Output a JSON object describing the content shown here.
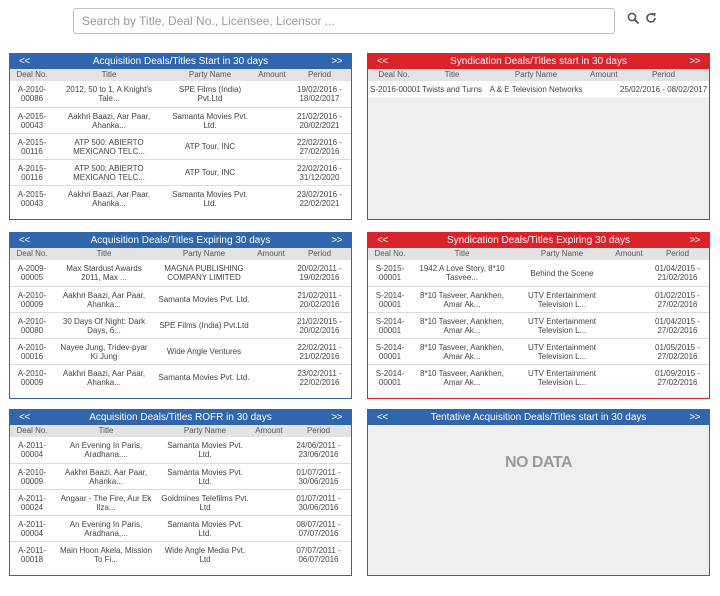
{
  "search": {
    "placeholder": "Search by Title, Deal No., Licensee, Licensor ..."
  },
  "icons": {
    "search": "search-icon",
    "refresh": "refresh-icon"
  },
  "colors": {
    "acquisition": "#2f66ad",
    "syndication": "#d9222a"
  },
  "nav": {
    "prev": "<<",
    "next": ">>"
  },
  "columns": {
    "deal_no": "Deal No.",
    "title": "Title",
    "party_name": "Party Name",
    "amount": "Amount",
    "period": "Period"
  },
  "panels": {
    "acq_start": {
      "title": "Acquisition Deals/Titles Start in 30 days",
      "rows": [
        {
          "deal_no": "A-2010-00086",
          "title": "2012, 50 to 1, A Knight's Tale...",
          "party": "SPE Films (India) Pvt.Ltd",
          "amount": "",
          "period": "19/02/2016 - 18/02/2017"
        },
        {
          "deal_no": "A-2015-00043",
          "title": "Aakhri Baazi, Aar Paar, Ahanka...",
          "party": "Samanta Movies Pvt. Ltd.",
          "amount": "",
          "period": "21/02/2016 - 20/02/2021"
        },
        {
          "deal_no": "A-2015-00116",
          "title": "ATP 500: ABIERTO MEXICANO TELC...",
          "party": "ATP Tour, INC",
          "amount": "",
          "period": "22/02/2016 - 27/02/2016"
        },
        {
          "deal_no": "A-2015-00116",
          "title": "ATP 500: ABIERTO MEXICANO TELC...",
          "party": "ATP Tour, INC",
          "amount": "",
          "period": "22/02/2016 - 31/12/2020"
        },
        {
          "deal_no": "A-2015-00043",
          "title": "Aakhri Baazi, Aar Paar, Ahanka...",
          "party": "Samanta Movies Pvt. Ltd.",
          "amount": "",
          "period": "23/02/2016 - 22/02/2021"
        }
      ]
    },
    "syn_start": {
      "title": "Syndication Deals/Titles start in 30 days",
      "rows": [
        {
          "deal_no": "S-2016-00001",
          "title": "Twists and Turns",
          "party": "A & E Television Networks",
          "amount": "",
          "period": "25/02/2016 - 08/02/2017"
        }
      ]
    },
    "acq_expiring": {
      "title": "Acquisition Deals/Titles Expiring 30 days",
      "rows": [
        {
          "deal_no": "A-2009-00005",
          "title": "Max Stardust Awards 2011, Max ...",
          "party": "MAGNA PUBLISHING COMPANY LIMITED",
          "amount": "",
          "period": "20/02/2011 - 19/02/2016"
        },
        {
          "deal_no": "A-2010-00009",
          "title": "Aakhri Baazi, Aar Paar, Ahanka...",
          "party": "Samanta Movies Pvt. Ltd.",
          "amount": "",
          "period": "21/02/2011 - 20/02/2016"
        },
        {
          "deal_no": "A-2010-00080",
          "title": "30 Days Of Night: Dark Days, 6...",
          "party": "SPE Films (India) Pvt.Ltd",
          "amount": "",
          "period": "21/02/2015 - 20/02/2016"
        },
        {
          "deal_no": "A-2010-00016",
          "title": "Nayee Jung, Tridev-pyar Ki Jung",
          "party": "Wide Angle Ventures",
          "amount": "",
          "period": "22/02/2011 - 21/02/2016"
        },
        {
          "deal_no": "A-2010-00009",
          "title": "Aakhri Baazi, Aar Paar, Ahanka...",
          "party": "Samanta Movies Pvt. Ltd.",
          "amount": "",
          "period": "23/02/2011 - 22/02/2016"
        }
      ]
    },
    "syn_expiring": {
      "title": "Syndication Deals/Titles Expiring 30 days",
      "rows": [
        {
          "deal_no": "S-2015-00001",
          "title": "1942 A Love Story, 8*10 Tasvee...",
          "party": "Behind the Scene",
          "amount": "",
          "period": "01/04/2015 - 21/02/2016"
        },
        {
          "deal_no": "S-2014-00001",
          "title": "8*10 Tasveer, Aankhen, Amar Ak...",
          "party": "UTV Entertainment Television L...",
          "amount": "",
          "period": "01/02/2015 - 27/02/2016"
        },
        {
          "deal_no": "S-2014-00001",
          "title": "8*10 Tasveer, Aankhen, Amar Ak...",
          "party": "UTV Entertainment Television L...",
          "amount": "",
          "period": "01/04/2015 - 27/02/2016"
        },
        {
          "deal_no": "S-2014-00001",
          "title": "8*10 Tasveer, Aankhen, Amar Ak...",
          "party": "UTV Entertainment Television L...",
          "amount": "",
          "period": "01/05/2015 - 27/02/2016"
        },
        {
          "deal_no": "S-2014-00001",
          "title": "8*10 Tasveer, Aankhen, Amar Ak...",
          "party": "UTV Entertainment Television L...",
          "amount": "",
          "period": "01/09/2015 - 27/02/2016"
        }
      ]
    },
    "acq_rofr": {
      "title": "Acquisition Deals/Titles ROFR in 30 days",
      "rows": [
        {
          "deal_no": "A-2011-00004",
          "title": "An Evening In Paris, Aradhana,...",
          "party": "Samanta Movies Pvt. Ltd.",
          "amount": "",
          "period": "24/06/2011 - 23/06/2016"
        },
        {
          "deal_no": "A-2010-00009",
          "title": "Aakhri Baazi, Aar Paar, Ahanka...",
          "party": "Samanta Movies Pvt. Ltd.",
          "amount": "",
          "period": "01/07/2011 - 30/06/2016"
        },
        {
          "deal_no": "A-2011-00024",
          "title": "Angaar - The Fire, Aur Ek Ilza...",
          "party": "Goldmines Telefilms Pvt. Ltd",
          "amount": "",
          "period": "01/07/2011 - 30/06/2016"
        },
        {
          "deal_no": "A-2011-00004",
          "title": "An Evening In Paris, Aradhana,...",
          "party": "Samanta Movies Pvt. Ltd.",
          "amount": "",
          "period": "08/07/2011 - 07/07/2016"
        },
        {
          "deal_no": "A-2011-00018",
          "title": "Main Hoon Akela, Mission To Fi...",
          "party": "Wide Angle Media Pvt. Ltd",
          "amount": "",
          "period": "07/07/2011 - 06/07/2016"
        }
      ]
    },
    "tentative": {
      "title": "Tentative Acquisition Deals/Titles start in 30 days",
      "empty_text": "NO DATA"
    }
  }
}
